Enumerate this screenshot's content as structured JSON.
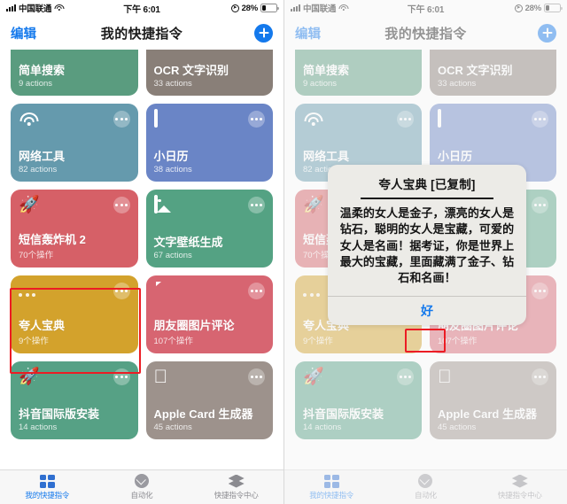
{
  "status_bar": {
    "carrier": "中国联通",
    "time": "下午 6:01",
    "battery_percent": "28%",
    "wifi_icon": "wifi-icon",
    "signal_icon": "signal-bars-icon",
    "location_icon": "location-arrow-icon",
    "battery_icon": "battery-icon"
  },
  "nav": {
    "edit_label": "编辑",
    "title": "我的快捷指令",
    "add_label": "+"
  },
  "cards": [
    {
      "title": "简单搜索",
      "subtitle": "9 actions",
      "color": "#5a9c7f",
      "icon": ""
    },
    {
      "title": "OCR 文字识别",
      "subtitle": "33 actions",
      "color": "#897f78",
      "icon": ""
    },
    {
      "title": "网络工具",
      "subtitle": "82 actions",
      "color": "#659aad",
      "icon": "wifi-icon"
    },
    {
      "title": "小日历",
      "subtitle": "38 actions",
      "color": "#6a85c6",
      "icon": "calendar-icon"
    },
    {
      "title": "短信轰炸机 2",
      "subtitle": "70个操作",
      "color": "#d66067",
      "icon": "rocket-icon"
    },
    {
      "title": "文字壁纸生成",
      "subtitle": "67 actions",
      "color": "#54a283",
      "icon": "photo-icon"
    },
    {
      "title": "夸人宝典",
      "subtitle": "9个操作",
      "color": "#d3a22c",
      "icon": "ellipsis-icon"
    },
    {
      "title": "朋友圈图片评论",
      "subtitle": "107个操作",
      "color": "#d76571",
      "icon": "message-icon"
    },
    {
      "title": "抖音国际版安装",
      "subtitle": "14 actions",
      "color": "#56a185",
      "icon": "rocket-icon"
    },
    {
      "title": " Apple Card 生成器",
      "subtitle": "45 actions",
      "color": "#9d928c",
      "icon": "apple-icon"
    }
  ],
  "tabs": [
    {
      "label": "我的快捷指令",
      "icon": "grid-icon",
      "active": true
    },
    {
      "label": "自动化",
      "icon": "clock-icon",
      "active": false
    },
    {
      "label": "快捷指令中心",
      "icon": "layers-icon",
      "active": false
    }
  ],
  "dialog": {
    "title": "夸人宝典 [已复制]",
    "text": "温柔的女人是金子，漂亮的女人是钻石，聪明的女人是宝藏，可爱的女人是名画！据考证，你是世界上最大的宝藏，里面藏满了金子、钻石和名画！",
    "button_label": "好"
  },
  "annotation": {
    "highlight_color": "#ec1c24"
  }
}
